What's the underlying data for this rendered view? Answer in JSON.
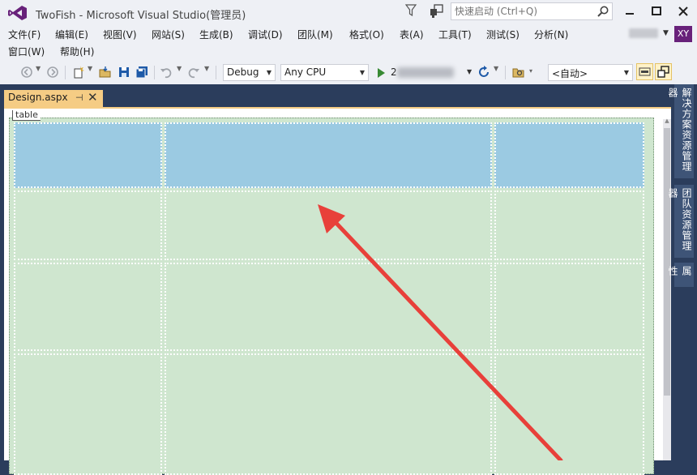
{
  "window": {
    "title": "TwoFish - Microsoft Visual Studio(管理员)",
    "quick_launch_placeholder": "快速启动 (Ctrl+Q)",
    "account_initials": "XY"
  },
  "menu": {
    "row1": [
      "文件(F)",
      "编辑(E)",
      "视图(V)",
      "网站(S)",
      "生成(B)",
      "调试(D)",
      "团队(M)",
      "格式(O)",
      "表(A)",
      "工具(T)",
      "测试(S)",
      "分析(N)"
    ],
    "row2": [
      "窗口(W)",
      "帮助(H)"
    ]
  },
  "toolbar": {
    "config": "Debug",
    "platform": "Any CPU",
    "run_label": "2",
    "target": "<自动>"
  },
  "document": {
    "tab_name": "Design.aspx",
    "pin_glyph": "⊣",
    "close_glyph": "✕",
    "element_tag": "table"
  },
  "right_panel": {
    "tabs": [
      "解决方案资源管理器",
      "团队资源管理器",
      "属性"
    ]
  },
  "colors": {
    "chrome": "#eef0f5",
    "frame": "#2b3d5c",
    "tab_active": "#f5cc84",
    "header_cells": "#9bcae2",
    "body_cells": "#cfe6cf",
    "annotation_arrow": "#e8403a"
  }
}
